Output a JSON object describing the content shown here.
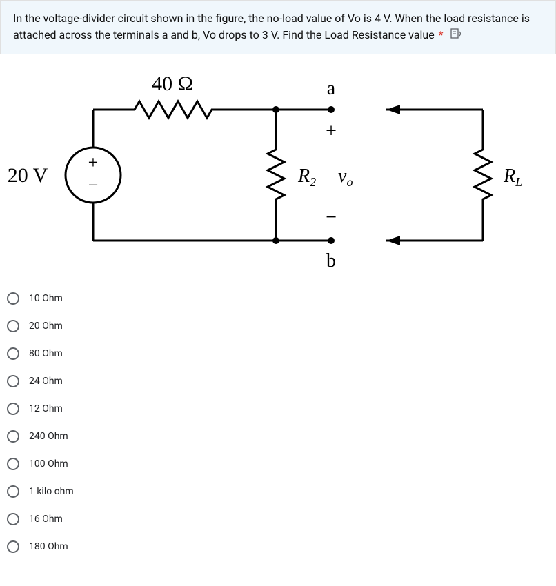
{
  "question": {
    "text": "In the voltage-divider circuit shown in the figure, the no-load value of Vo is 4 V. When the load resistance is attached across the terminals a and b, Vo drops to 3 V. Find the Load Resistance value",
    "required_marker": "*"
  },
  "circuit": {
    "source_voltage": "20 V",
    "r1_label": "40 Ω",
    "r2_label": "R",
    "r2_sub": "2",
    "vo_label": "v",
    "vo_sub": "o",
    "rl_label": "R",
    "rl_sub": "L",
    "terminal_a": "a",
    "terminal_b": "b",
    "plus": "+",
    "minus": "−"
  },
  "options": [
    {
      "label": "10 Ohm"
    },
    {
      "label": "20 Ohm"
    },
    {
      "label": "80 Ohm"
    },
    {
      "label": "24 Ohm"
    },
    {
      "label": "12 Ohm"
    },
    {
      "label": "240 Ohm"
    },
    {
      "label": "100 Ohm"
    },
    {
      "label": "1 kilo ohm"
    },
    {
      "label": "16 Ohm"
    },
    {
      "label": "180 Ohm"
    }
  ]
}
